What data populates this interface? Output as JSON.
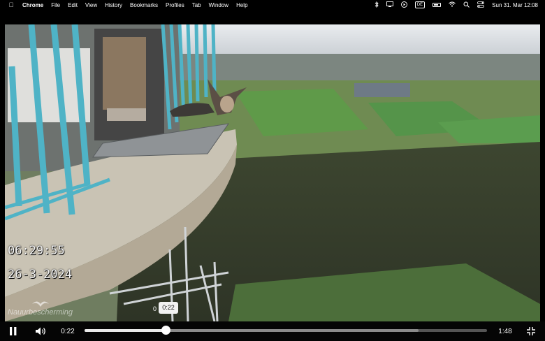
{
  "menubar": {
    "app_name": "Chrome",
    "items": [
      "File",
      "Edit",
      "View",
      "History",
      "Bookmarks",
      "Profiles",
      "Tab",
      "Window",
      "Help"
    ],
    "keyboard_layout": "DE",
    "clock": "Sun 31. Mar  12:08",
    "status_icons": [
      "bluetooth-icon",
      "display-icon",
      "play-circle-icon",
      "keyboard-layout-icon",
      "battery-icon",
      "wifi-icon",
      "search-icon",
      "control-center-icon"
    ]
  },
  "video": {
    "osd_time": "06:29:55",
    "osd_date": "26-3-2024",
    "watermark": "Nauurbescherming",
    "hover_tooltip": "0:22",
    "hover_tooltip_under": "0"
  },
  "player": {
    "current_time": "0:22",
    "duration": "1:48",
    "progress": 0.203,
    "buffered": 0.83,
    "colors": {
      "track": "#555555",
      "fill": "#eaeaea",
      "buffered": "#8a8a8a"
    }
  }
}
